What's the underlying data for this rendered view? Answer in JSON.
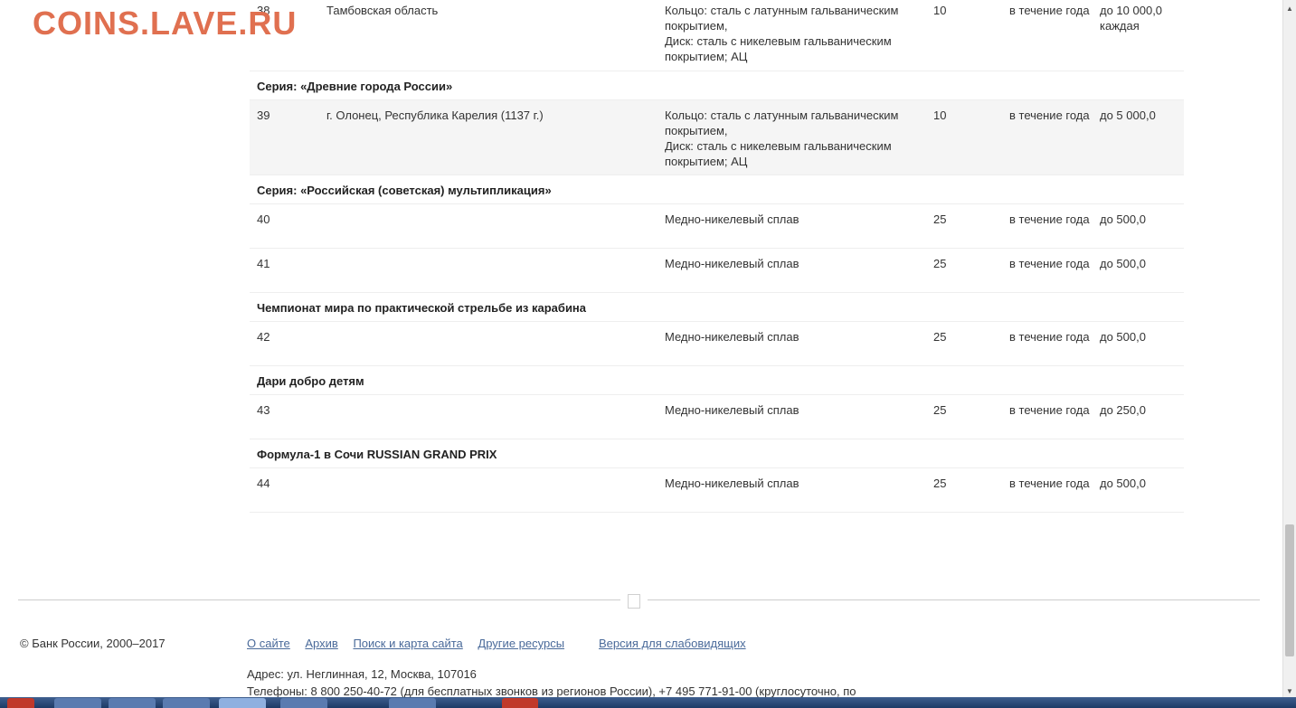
{
  "watermark": "COINS.LAVE.RU",
  "rows": [
    {
      "num": "38",
      "name": "Тамбовская область",
      "material": "Кольцо: сталь с латунным гальваническим покрытием,\nДиск: сталь с никелевым гальваническим покрытием; АЦ",
      "quantity": "10",
      "term": "в течение года",
      "mintage": "до 10 000,0 каждая"
    },
    {
      "series": "Серия: «Древние города России»"
    },
    {
      "num": "39",
      "name": "г. Олонец, Республика Карелия (1137 г.)",
      "material": "Кольцо: сталь с латунным гальваническим покрытием,\nДиск: сталь с никелевым гальваническим покрытием; АЦ",
      "quantity": "10",
      "term": "в течение года",
      "mintage": "до 5 000,0"
    },
    {
      "series": "Серия: «Российская (советская) мультипликация»"
    },
    {
      "num": "40",
      "name": "",
      "material": "Медно-никелевый сплав",
      "quantity": "25",
      "term": "в течение года",
      "mintage": "до 500,0"
    },
    {
      "num": "41",
      "name": "",
      "material": "Медно-никелевый сплав",
      "quantity": "25",
      "term": "в течение года",
      "mintage": "до 500,0"
    },
    {
      "series": "Чемпионат мира по практической стрельбе из карабина"
    },
    {
      "num": "42",
      "name": "",
      "material": "Медно-никелевый сплав",
      "quantity": "25",
      "term": "в течение года",
      "mintage": "до 500,0"
    },
    {
      "series": "Дари добро детям"
    },
    {
      "num": "43",
      "name": "",
      "material": "Медно-никелевый сплав",
      "quantity": "25",
      "term": "в течение года",
      "mintage": "до 250,0"
    },
    {
      "series": "Формула-1 в Сочи RUSSIAN GRAND PRIX"
    },
    {
      "num": "44",
      "name": "",
      "material": "Медно-никелевый сплав",
      "quantity": "25",
      "term": "в течение года",
      "mintage": "до 500,0"
    }
  ],
  "footer": {
    "copyright": "© Банк России, 2000–2017",
    "links": [
      "О сайте",
      "Архив",
      "Поиск и карта сайта",
      "Другие ресурсы"
    ],
    "vision_link": "Версия для слабовидящих",
    "address": "Адрес: ул. Неглинная, 12, Москва, 107016",
    "phones": "Телефоны: 8 800 250-40-72 (для бесплатных звонков из регионов России), +7 495 771-91-00 (круглосуточно, по"
  },
  "colors": {
    "link": "#4a6a9a",
    "watermark": "#e07050",
    "alt_row": "#f5f5f5"
  }
}
